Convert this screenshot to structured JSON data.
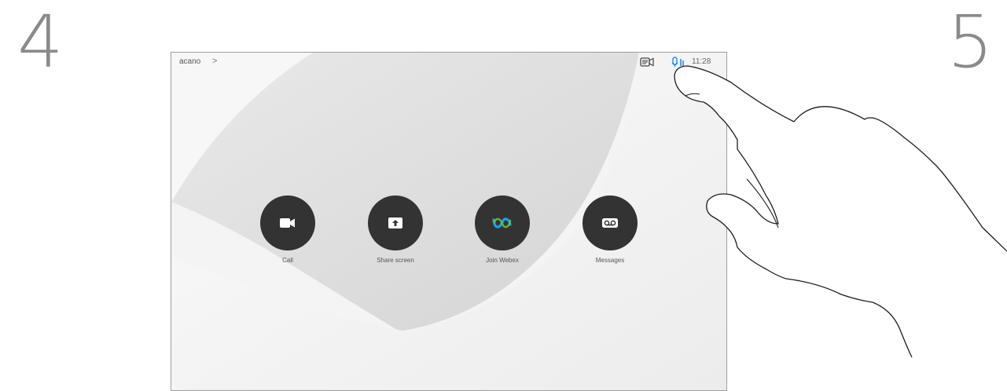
{
  "steps": {
    "left": "4",
    "right": "5"
  },
  "topbar": {
    "breadcrumb": "acano",
    "breadcrumb_chevron": ">",
    "time": "11:28"
  },
  "actions": [
    {
      "label": "Call",
      "icon": "video-camera-icon"
    },
    {
      "label": "Share screen",
      "icon": "share-screen-icon"
    },
    {
      "label": "Join Webex",
      "icon": "webex-logo-icon"
    },
    {
      "label": "Messages",
      "icon": "voicemail-icon"
    }
  ],
  "colors": {
    "button_bg": "#333333",
    "accent_blue": "#1d8cf8",
    "webex_blue": "#1aa3e8",
    "webex_green": "#6ccc3a"
  }
}
